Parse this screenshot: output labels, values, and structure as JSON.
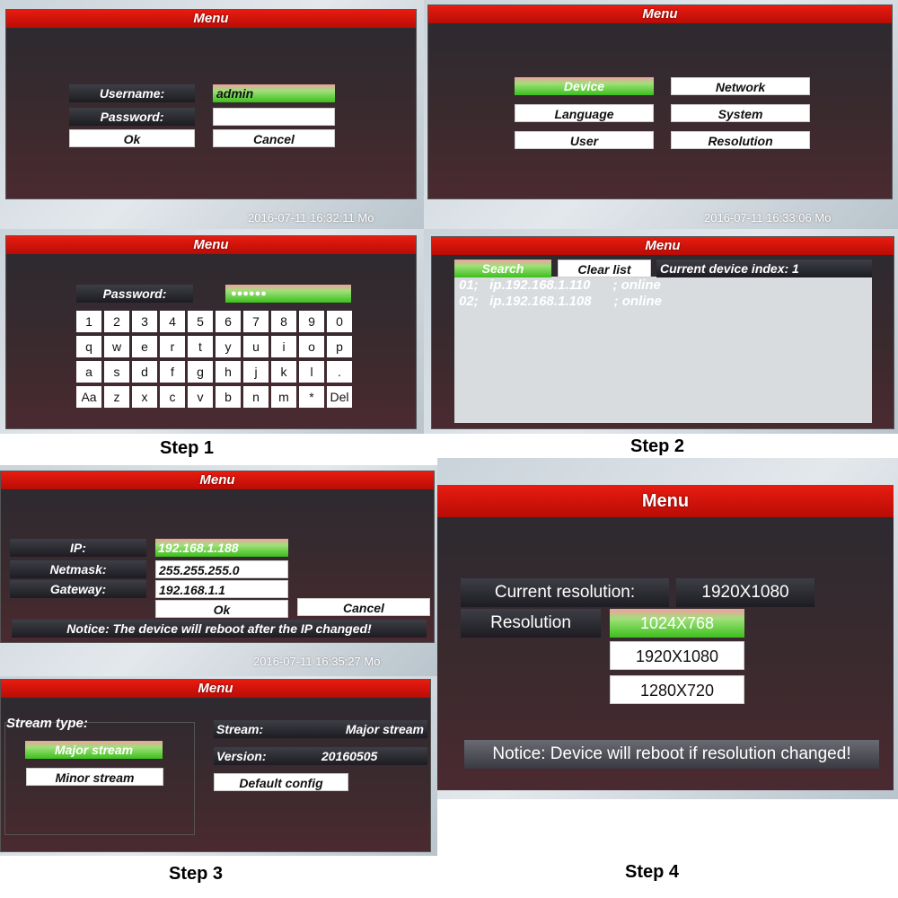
{
  "menu_title": "Menu",
  "steps": [
    "Step 1",
    "Step 2",
    "Step 3",
    "Step 4"
  ],
  "timestamps": [
    "2016-07-11 16:32:11 Mo",
    "2016-07-11 16:33:06 Mo",
    "2016-07-11 16:35:27 Mo"
  ],
  "login": {
    "username_label": "Username:",
    "username_value": "admin",
    "password_label": "Password:",
    "password_value": "",
    "ok": "Ok",
    "cancel": "Cancel"
  },
  "main_menu": {
    "items": [
      "Device",
      "Network",
      "Language",
      "System",
      "User",
      "Resolution"
    ],
    "selected": "Device"
  },
  "password_keyboard": {
    "label": "Password:",
    "value": "●●●●●●",
    "rows": [
      [
        "1",
        "2",
        "3",
        "4",
        "5",
        "6",
        "7",
        "8",
        "9",
        "0"
      ],
      [
        "q",
        "w",
        "e",
        "r",
        "t",
        "y",
        "u",
        "i",
        "o",
        "p"
      ],
      [
        "a",
        "s",
        "d",
        "f",
        "g",
        "h",
        "j",
        "k",
        "l",
        "."
      ],
      [
        "Aa",
        "z",
        "x",
        "c",
        "v",
        "b",
        "n",
        "m",
        "*",
        "Del"
      ]
    ]
  },
  "device_list": {
    "search": "Search",
    "clear": "Clear list",
    "index_label": "Current device index:",
    "index_value": "1",
    "rows": [
      "01;   ip.192.168.1.110      ; online",
      "02;   ip.192.168.1.108      ; online"
    ]
  },
  "network": {
    "ip_label": "IP:",
    "ip": "192.168.1.188",
    "netmask_label": "Netmask:",
    "netmask": "255.255.255.0",
    "gateway_label": "Gateway:",
    "gateway": "192.168.1.1",
    "ok": "Ok",
    "cancel": "Cancel",
    "notice": "Notice: The device will reboot after the IP changed!"
  },
  "stream": {
    "type_label": "Stream type:",
    "major": "Major stream",
    "minor": "Minor stream",
    "stream_label": "Stream:",
    "stream_value": "Major stream",
    "version_label": "Version:",
    "version_value": "20160505",
    "default": "Default config"
  },
  "resolution": {
    "current_label": "Current resolution:",
    "current_value": "1920X1080",
    "label": "Resolution",
    "options": [
      "1024X768",
      "1920X1080",
      "1280X720"
    ],
    "selected": "1024X768",
    "notice": "Notice: Device will reboot if resolution changed!"
  },
  "colors": {
    "bar": "#d81408",
    "selected": "#3cbf1c"
  }
}
